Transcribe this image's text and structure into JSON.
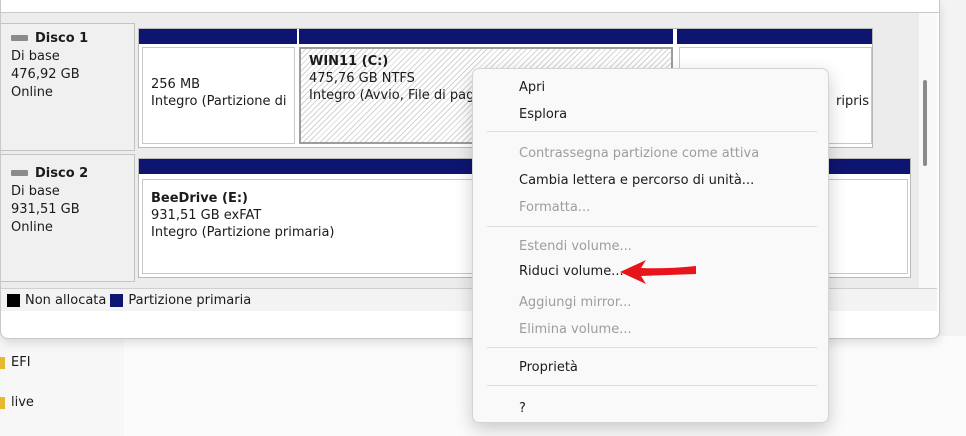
{
  "disks": [
    {
      "title": "Disco 1",
      "type": "Di base",
      "size": "476,92 GB",
      "status": "Online",
      "partitions": [
        {
          "name": "",
          "size": "256 MB",
          "status": "Integro (Partizione di"
        },
        {
          "name": "WIN11  (C:)",
          "size": "475,76 GB NTFS",
          "status": "Integro (Avvio, File di pag"
        },
        {
          "name": "",
          "size": "",
          "status": "ripris"
        }
      ]
    },
    {
      "title": "Disco 2",
      "type": "Di base",
      "size": "931,51 GB",
      "status": "Online",
      "partitions": [
        {
          "name": "BeeDrive  (E:)",
          "size": "931,51 GB exFAT",
          "status": "Integro (Partizione primaria)"
        }
      ]
    }
  ],
  "legend": {
    "unallocated": "Non allocata",
    "primary": "Partizione primaria"
  },
  "tree": [
    "EFI",
    "live"
  ],
  "context_menu": {
    "open": "Apri",
    "explore": "Esplora",
    "mark_active": "Contrassegna partizione come attiva",
    "change_letter": "Cambia lettera e percorso di unità...",
    "format": "Formatta...",
    "extend": "Estendi volume...",
    "shrink": "Riduci volume...",
    "add_mirror": "Aggiungi mirror...",
    "delete": "Elimina volume...",
    "properties": "Proprietà",
    "help": "?"
  },
  "colors": {
    "primary_partition": "#0e1570",
    "unallocated": "#000000",
    "annotation_arrow": "#e8141c"
  }
}
